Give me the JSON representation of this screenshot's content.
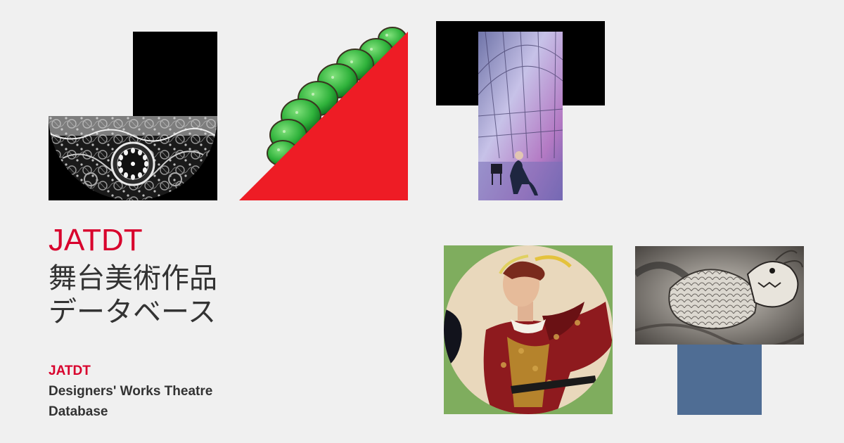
{
  "brand": {
    "title_en": "JATDT",
    "title_ja_line1": "舞台美術作品",
    "title_ja_line2": "データベース",
    "subtitle_line1": "JATDT",
    "subtitle_line2": "Designers' Works Theatre",
    "subtitle_line3": "Database"
  },
  "colors": {
    "background": "#f0f0f0",
    "accent_red": "#d8002c",
    "triangle_red": "#ee1c25",
    "text_dark": "#333333",
    "tile_black": "#000000",
    "tile_green": "#7fad5e",
    "tile_blue": "#4f6d94"
  },
  "artworks": [
    {
      "name": "ornate-clock-artwork"
    },
    {
      "name": "green-foliage-artwork"
    },
    {
      "name": "stage-photo-artwork"
    },
    {
      "name": "costume-painting-artwork"
    },
    {
      "name": "dragon-ink-artwork"
    }
  ]
}
